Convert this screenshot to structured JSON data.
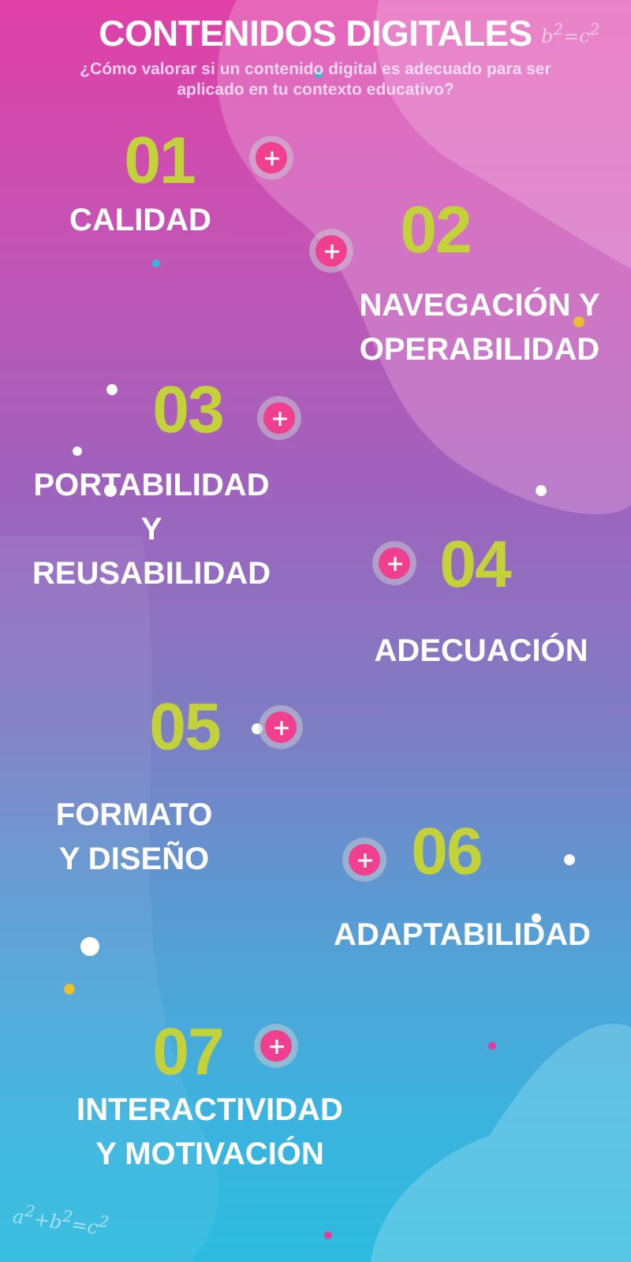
{
  "title": "CONTENIDOS DIGITALES",
  "subtitle": "¿Cómo valorar si un contenido digital es adecuado para ser aplicado en tu contexto educativo?",
  "doodles": [
    "b$^{2}$=c$^{2}$",
    "a$^{2}$+b$^{2}$=c$^{2}$"
  ],
  "items": [
    {
      "number": "01",
      "label": "CALIDAD"
    },
    {
      "number": "02",
      "label": "NAVEGACIÓN Y\nOPERABILIDAD"
    },
    {
      "number": "03",
      "label": "PORTABILIDAD\nY\nREUSABILIDAD"
    },
    {
      "number": "04",
      "label": "ADECUACIÓN"
    },
    {
      "number": "05",
      "label": "FORMATO\nY DISEÑO"
    },
    {
      "number": "06",
      "label": "ADAPTABILIDAD"
    },
    {
      "number": "07",
      "label": "INTERACTIVIDAD\nY MOTIVACIÓN"
    }
  ]
}
